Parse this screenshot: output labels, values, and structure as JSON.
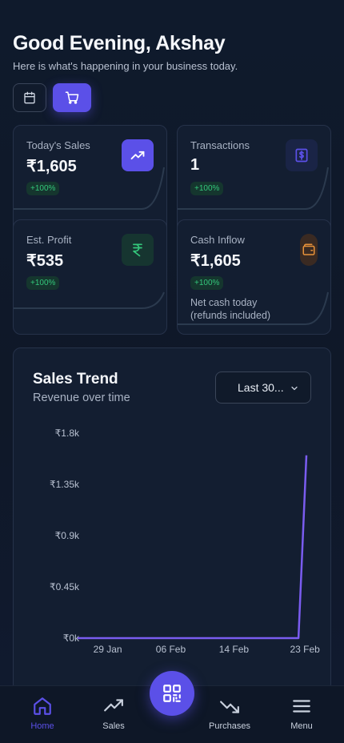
{
  "header": {
    "greeting": "Good Evening, Akshay",
    "subtitle": "Here is what's happening in your business today."
  },
  "toggles": [
    {
      "icon": "calendar-icon",
      "active": false
    },
    {
      "icon": "cart-icon",
      "active": true
    }
  ],
  "stats": {
    "sales": {
      "label": "Today's Sales",
      "value": "₹1,605",
      "badge": "+100%",
      "icon": "trending-up-icon"
    },
    "transactions": {
      "label": "Transactions",
      "value": "1",
      "badge": "+100%",
      "icon": "receipt-dollar-icon"
    },
    "profit": {
      "label": "Est. Profit",
      "value": "₹535",
      "badge": "+100%",
      "icon": "rupee-icon"
    },
    "inflow": {
      "label": "Cash Inflow",
      "value": "₹1,605",
      "badge": "+100%",
      "note_line1": "Net cash today",
      "note_line2": "(refunds included)",
      "icon": "wallet-icon"
    }
  },
  "trend": {
    "title": "Sales Trend",
    "subtitle": "Revenue over time",
    "range_label": "Last 30...",
    "y_ticks": [
      "₹1.8k",
      "₹1.35k",
      "₹0.9k",
      "₹0.45k",
      "₹0k"
    ],
    "x_ticks": [
      "29 Jan",
      "06 Feb",
      "14 Feb",
      "23 Feb"
    ]
  },
  "chart_data": {
    "type": "line",
    "title": "Sales Trend",
    "subtitle": "Revenue over time",
    "x_ticks": [
      "29 Jan",
      "06 Feb",
      "14 Feb",
      "23 Feb"
    ],
    "ylim": [
      0,
      1800
    ],
    "y_ticks": [
      0,
      450,
      900,
      1350,
      1800
    ],
    "series": [
      {
        "x": [
          "26 Jan",
          "29 Jan",
          "06 Feb",
          "14 Feb",
          "22 Feb",
          "23 Feb",
          "24 Feb"
        ],
        "values": [
          0,
          0,
          0,
          0,
          0,
          0,
          1605
        ]
      }
    ],
    "grid": false,
    "line_color": "#7a5cf0"
  },
  "nav": {
    "home": "Home",
    "sales": "Sales",
    "purchases": "Purchases",
    "menu": "Menu",
    "scan_icon": "qr-scan-icon"
  },
  "colors": {
    "accent": "#5b50e8",
    "positive": "#34c77b",
    "orange": "#e8923a"
  }
}
